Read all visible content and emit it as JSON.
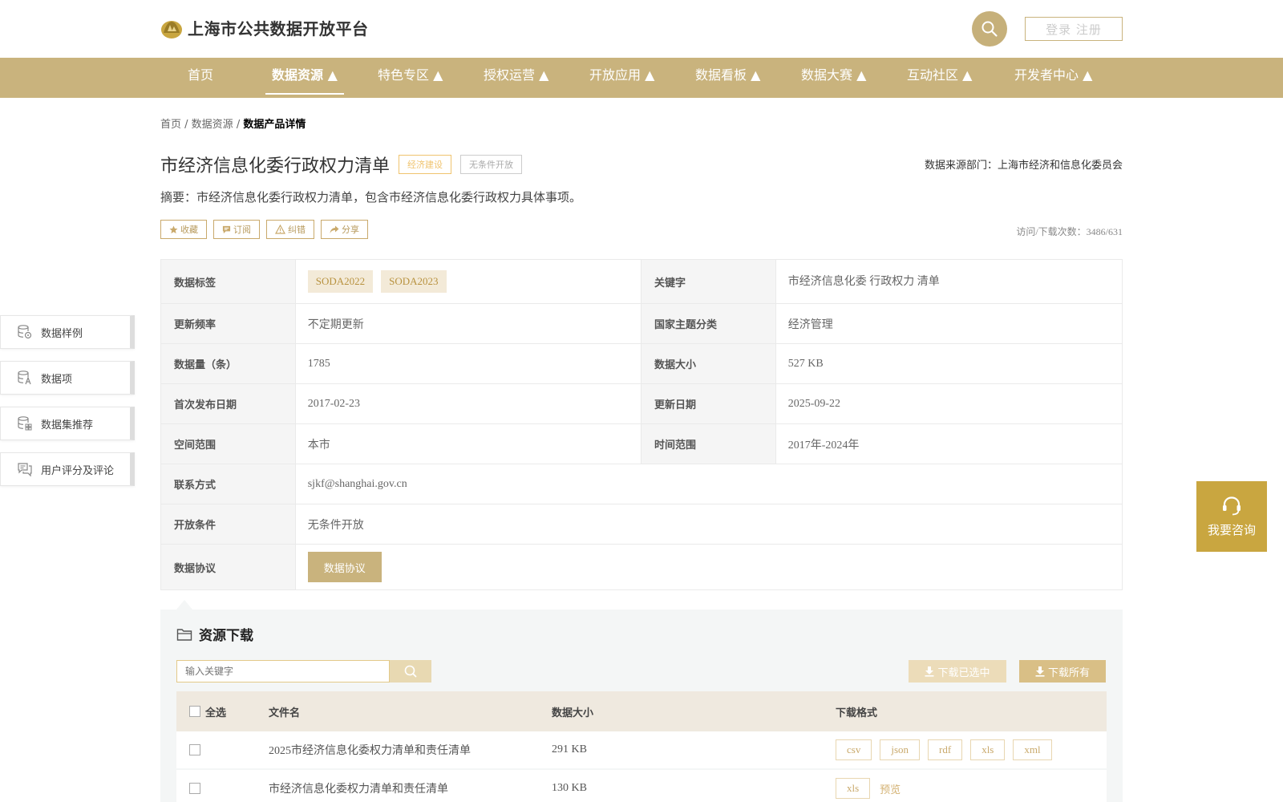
{
  "header": {
    "site_title": "上海市公共数据开放平台",
    "login_label": "登录 注册"
  },
  "nav": {
    "items": [
      {
        "label": "首页"
      },
      {
        "label": "数据资源 ▲"
      },
      {
        "label": "特色专区 ▲"
      },
      {
        "label": "授权运营 ▲"
      },
      {
        "label": "开放应用 ▲"
      },
      {
        "label": "数据看板 ▲"
      },
      {
        "label": "数据大赛 ▲"
      },
      {
        "label": "互动社区 ▲"
      },
      {
        "label": "开发者中心 ▲"
      }
    ],
    "active_index": 1
  },
  "breadcrumb": {
    "home": "首页",
    "sep1": " / ",
    "section": "数据资源",
    "sep2": " / ",
    "current": "数据产品详情"
  },
  "dataset": {
    "title": "市经济信息化委行政权力清单",
    "tag_category": "经济建设",
    "tag_open": "无条件开放",
    "source": "数据来源部门：上海市经济和信息化委员会",
    "summary": "摘要：市经济信息化委行政权力清单，包含市经济信息化委行政权力具体事项。",
    "visits": "访问/下载次数：3486/631"
  },
  "actions": {
    "favorite": "收藏",
    "subscribe": "订阅",
    "correct": "纠错",
    "share": "分享"
  },
  "info": {
    "tags_label": "数据标签",
    "tags": [
      "SODA2022",
      "SODA2023"
    ],
    "keywords_label": "关键字",
    "keywords": "市经济信息化委 行政权力 清单",
    "freq_label": "更新频率",
    "freq": "不定期更新",
    "theme_label": "国家主题分类",
    "theme": "经济管理",
    "count_label": "数据量（条）",
    "count": "1785",
    "size_label": "数据大小",
    "size": "527 KB",
    "first_pub_label": "首次发布日期",
    "first_pub": "2017-02-23",
    "updated_label": "更新日期",
    "updated": "2025-09-22",
    "space_label": "空间范围",
    "space": "本市",
    "time_label": "时间范围",
    "time": "2017年-2024年",
    "contact_label": "联系方式",
    "contact": "sjkf@shanghai.gov.cn",
    "cond_label": "开放条件",
    "cond": "无条件开放",
    "protocol_label": "数据协议",
    "protocol_btn": "数据协议"
  },
  "sidebar": {
    "items": [
      {
        "label": "数据样例"
      },
      {
        "label": "数据项"
      },
      {
        "label": "数据集推荐"
      },
      {
        "label": "用户评分及评论"
      }
    ]
  },
  "consult": {
    "label": "我要咨询"
  },
  "resources": {
    "title": "资源下载",
    "search_placeholder": "输入关键字",
    "download_selected": "下载已选中",
    "download_all": "下载所有",
    "headers": {
      "select_all": "全选",
      "filename": "文件名",
      "size": "数据大小",
      "format": "下载格式"
    },
    "rows": [
      {
        "name": "2025市经济信息化委权力清单和责任清单",
        "size": "291 KB",
        "formats": [
          "csv",
          "json",
          "rdf",
          "xls",
          "xml"
        ]
      },
      {
        "name": "市经济信息化委权力清单和责任清单",
        "size": "130 KB",
        "formats": [
          "xls"
        ],
        "preview": "预览"
      }
    ]
  },
  "colors": {
    "primary_gold": "#c9b37d",
    "consult_gold": "#c9a640",
    "tag_orange": "#f0c46f"
  }
}
